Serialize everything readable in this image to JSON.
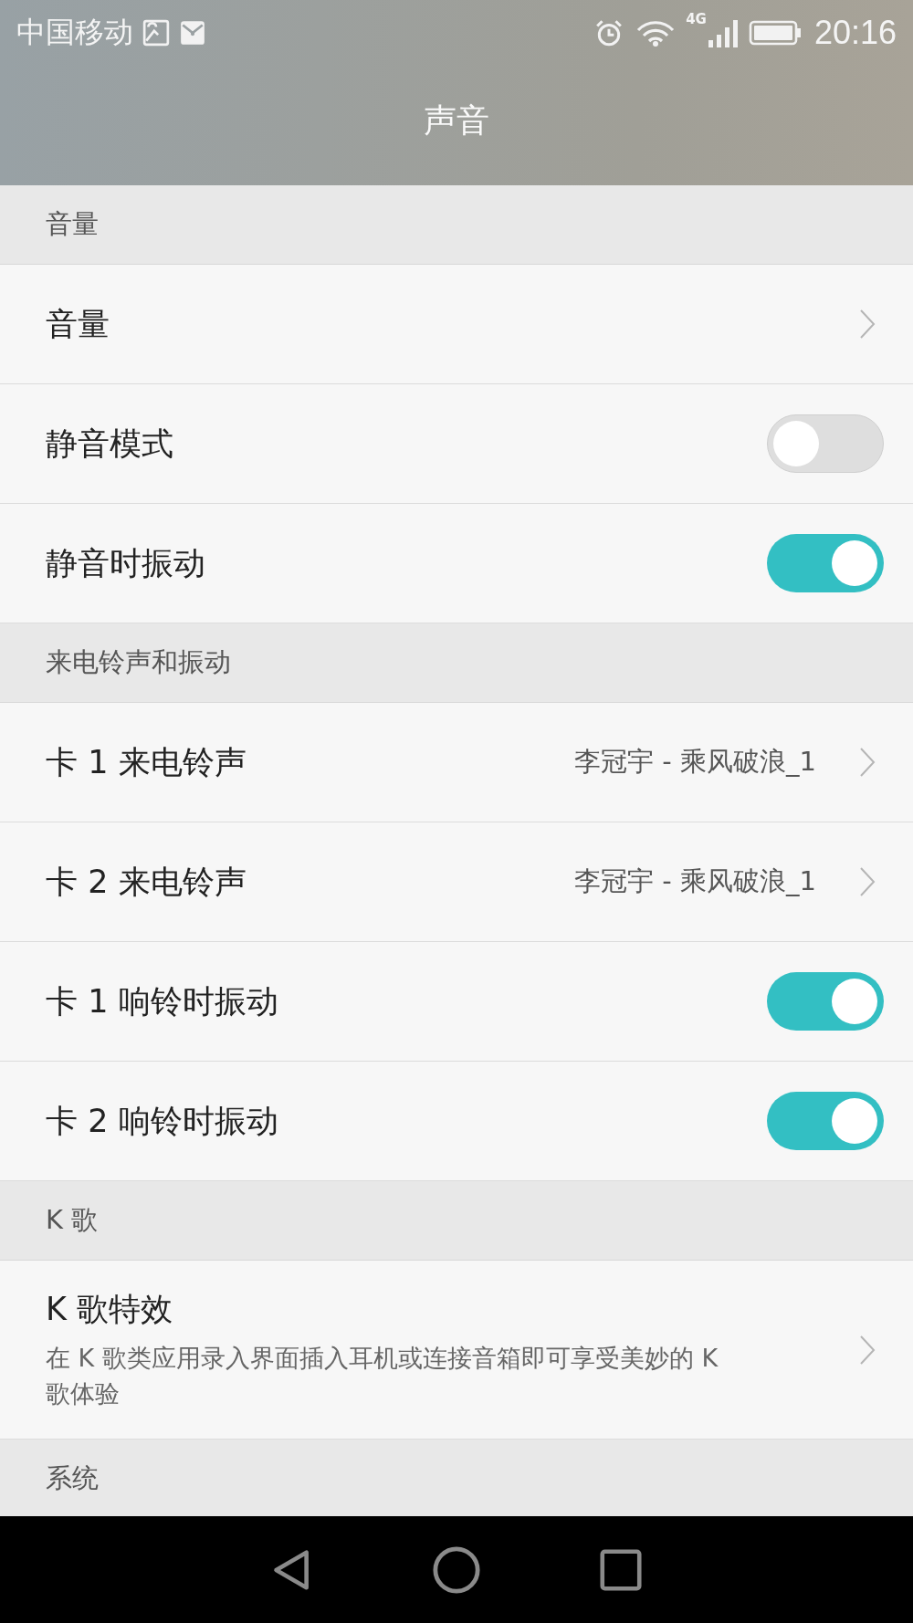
{
  "status_bar": {
    "carrier": "中国移动",
    "network": "4G",
    "time": "20:16"
  },
  "title": "声音",
  "sections": [
    {
      "header": "音量",
      "items": [
        {
          "kind": "link",
          "label": "音量"
        },
        {
          "kind": "toggle",
          "label": "静音模式",
          "on": false
        },
        {
          "kind": "toggle",
          "label": "静音时振动",
          "on": true
        }
      ]
    },
    {
      "header": "来电铃声和振动",
      "items": [
        {
          "kind": "link",
          "label": "卡 1 来电铃声",
          "value": "李冠宇 - 乘风破浪_1"
        },
        {
          "kind": "link",
          "label": "卡 2 来电铃声",
          "value": "李冠宇 - 乘风破浪_1"
        },
        {
          "kind": "toggle",
          "label": "卡 1 响铃时振动",
          "on": true
        },
        {
          "kind": "toggle",
          "label": "卡 2 响铃时振动",
          "on": true
        }
      ]
    },
    {
      "header": "K 歌",
      "items": [
        {
          "kind": "link",
          "label": "K 歌特效",
          "description": "在 K 歌类应用录入界面插入耳机或连接音箱即可享受美妙的 K 歌体验"
        }
      ]
    },
    {
      "header": "系统"
    }
  ]
}
